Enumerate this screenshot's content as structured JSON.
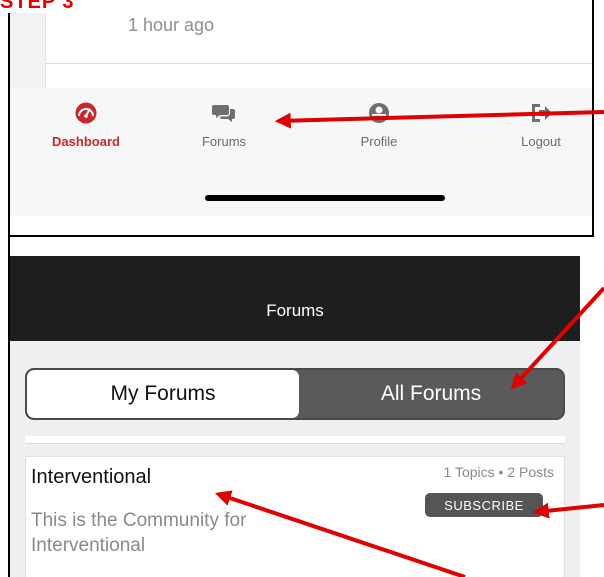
{
  "step_label": "STEP 3",
  "feed": {
    "timestamp": "1 hour ago"
  },
  "tabbar": {
    "items": [
      {
        "label": "Dashboard",
        "icon": "dashboard-gauge-icon",
        "active": true
      },
      {
        "label": "Forums",
        "icon": "chat-bubbles-icon",
        "active": false
      },
      {
        "label": "Profile",
        "icon": "person-icon",
        "active": false
      },
      {
        "label": "Logout",
        "icon": "logout-icon",
        "active": false
      }
    ]
  },
  "forums_screen": {
    "title": "Forums",
    "segments": [
      "My Forums",
      "All Forums"
    ],
    "selected_segment": "My Forums",
    "forum": {
      "name": "Interventional",
      "description": "This is the Community for Interventional",
      "stats": "1 Topics • 2 Posts",
      "subscribe_label": "SUBSCRIBE"
    }
  },
  "colors": {
    "accent_red": "#c8272d",
    "annotation_red": "#e00000",
    "navbar": "#1e1e1e",
    "segment_dark": "#5a5a5a"
  }
}
